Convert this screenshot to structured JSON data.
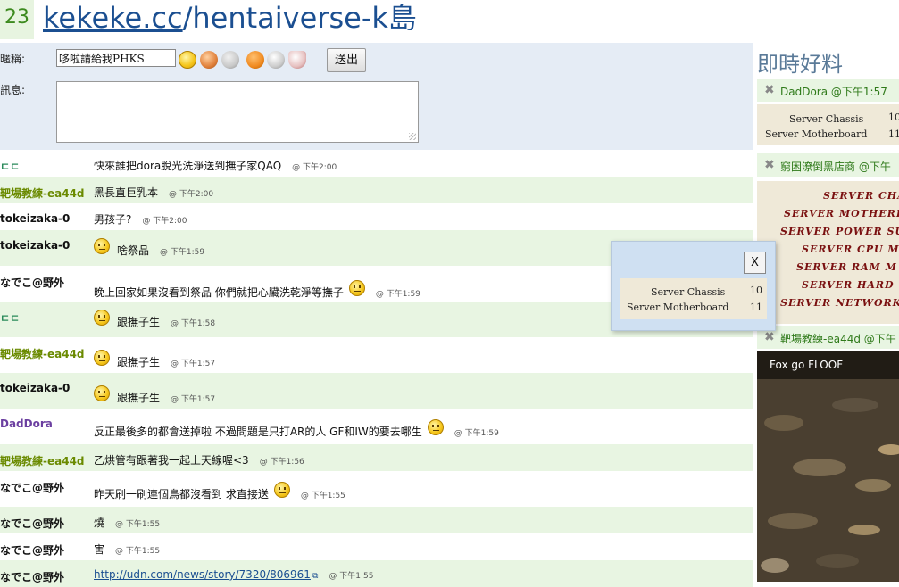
{
  "header": {
    "count": "23",
    "title_domain": "kekeke.cc",
    "title_path": "/hentaiverse-k島"
  },
  "form": {
    "nick_label": "暱稱:",
    "nick_value": "哆啦請給我PHKS",
    "msg_label": "訊息:",
    "send_label": "送出",
    "emoticons": [
      "smile-icon",
      "heart-icon",
      "magnify-icon",
      "peace-icon",
      "handcuffs-icon",
      "shield-icon"
    ]
  },
  "colors": {
    "user_green": "#6a8a00",
    "user_dark": "#111111",
    "user_purple": "#6b3fa0",
    "user_teal": "#2a8a5a",
    "accent": "#1b4f91"
  },
  "messages": [
    {
      "user": "ㄷㄷ",
      "text": "快來誰把dora脫光洗淨送到撫子家QAQ",
      "ts": "@ 下午2:00",
      "smiley": false,
      "color": "#2a8a5a"
    },
    {
      "user": "靶場教練-ea44d",
      "text": "黑長直巨乳本",
      "ts": "@ 下午2:00",
      "smiley": false,
      "color": "#6a8a00"
    },
    {
      "user": "tokeizaka-0",
      "text": "男孩子?",
      "ts": "@ 下午2:00",
      "smiley": false,
      "color": "#111111"
    },
    {
      "user": "tokeizaka-0",
      "text": "啥祭品",
      "ts": "@ 下午1:59",
      "smiley": true,
      "color": "#111111"
    },
    {
      "user": "なでこ@野外",
      "text": "晚上回家如果沒看到祭品 你們就把心臟洗乾淨等撫子",
      "ts": "@ 下午1:59",
      "smiley": true,
      "color": "#111111"
    },
    {
      "user": "ㄷㄷ",
      "text": "跟撫子生",
      "ts": "@ 下午1:58",
      "smiley": true,
      "color": "#2a8a5a"
    },
    {
      "user": "靶場教練-ea44d",
      "text": "跟撫子生",
      "ts": "@ 下午1:57",
      "smiley": true,
      "color": "#6a8a00"
    },
    {
      "user": "tokeizaka-0",
      "text": "跟撫子生",
      "ts": "@ 下午1:57",
      "smiley": true,
      "color": "#111111"
    },
    {
      "user": "DadDora",
      "text": "反正最後多的都會送掉啦 不過問題是只打AR的人 GF和IW的要去哪生",
      "ts": "@ 下午1:59",
      "smiley": true,
      "color": "#6b3fa0"
    },
    {
      "user": "靶場教練-ea44d",
      "text": "乙烘管有跟著我一起上天線喔<3",
      "ts": "@ 下午1:56",
      "smiley": false,
      "color": "#6a8a00"
    },
    {
      "user": "なでこ@野外",
      "text": "昨天刷一刷連個鳥都沒看到 求直接送",
      "ts": "@ 下午1:55",
      "smiley": true,
      "color": "#111111"
    },
    {
      "user": "なでこ@野外",
      "text": "燒",
      "ts": "@ 下午1:55",
      "smiley": false,
      "color": "#111111"
    },
    {
      "user": "なでこ@野外",
      "text": "害",
      "ts": "@ 下午1:55",
      "smiley": false,
      "color": "#111111"
    },
    {
      "user": "なでこ@野外",
      "text": "http://udn.com/news/story/7320/806961",
      "ts": "@ 下午1:55",
      "smiley": false,
      "color": "#111111",
      "link": true
    }
  ],
  "sidebar": {
    "title": "即時好料",
    "feed1_head": "DadDora @下午1:57",
    "feed1_items": [
      {
        "name": "Server Chassis",
        "qty": "10"
      },
      {
        "name": "Server Motherboard",
        "qty": "11"
      }
    ],
    "feed2_head": "窮困潦倒黑店商 @下午",
    "feed2_items": [
      "SERVER CHA",
      "SERVER MOTHERB",
      "SERVER POWER SU",
      "SERVER CPU M",
      "SERVER RAM M",
      "SERVER HARD",
      "SERVER NETWORK"
    ],
    "feed3_head": "靶場教練-ea44d @下午",
    "video_caption": "Fox go FLOOF"
  },
  "popup": {
    "close_label": "X",
    "items": [
      {
        "name": "Server Chassis",
        "qty": "10"
      },
      {
        "name": "Server Motherboard",
        "qty": "11"
      }
    ]
  }
}
